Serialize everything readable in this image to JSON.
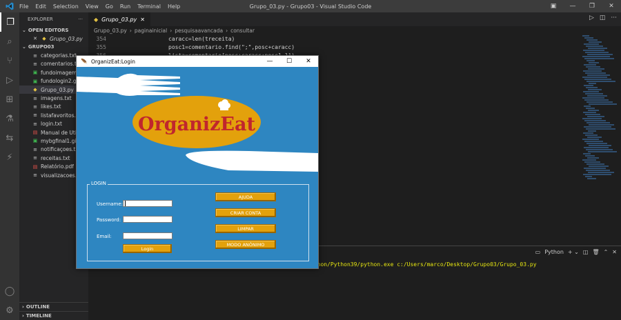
{
  "titlebar": {
    "menu": [
      "File",
      "Edit",
      "Selection",
      "View",
      "Go",
      "Run",
      "Terminal",
      "Help"
    ],
    "title": "Grupo_03.py - Grupo03 - Visual Studio Code"
  },
  "sidebar": {
    "header": "EXPLORER",
    "open_editors_label": "OPEN EDITORS",
    "open_file": "Grupo_03.py",
    "folder_label": "GRUPO03",
    "files": [
      {
        "name": "categorias.txt",
        "icon": "text-file-icon"
      },
      {
        "name": "comentarios.txt",
        "icon": "text-file-icon"
      },
      {
        "name": "fundoimagem...",
        "icon": "image-file-icon"
      },
      {
        "name": "fundologin2.gif",
        "icon": "image-file-icon"
      },
      {
        "name": "Grupo_03.py",
        "icon": "python-file-icon"
      },
      {
        "name": "imagens.txt",
        "icon": "text-file-icon"
      },
      {
        "name": "likes.txt",
        "icon": "text-file-icon"
      },
      {
        "name": "listafavoritos.txt",
        "icon": "text-file-icon"
      },
      {
        "name": "login.txt",
        "icon": "text-file-icon"
      },
      {
        "name": "Manual de Utili...",
        "icon": "pdf-file-icon"
      },
      {
        "name": "mybgfinal1.gif",
        "icon": "image-file-icon"
      },
      {
        "name": "notificaçoes.txt",
        "icon": "text-file-icon"
      },
      {
        "name": "receitas.txt",
        "icon": "text-file-icon"
      },
      {
        "name": "Relatório.pdf",
        "icon": "pdf-file-icon"
      },
      {
        "name": "visualizacoes.txt",
        "icon": "text-file-icon"
      }
    ],
    "outline_label": "OUTLINE",
    "timeline_label": "TIMELINE"
  },
  "editor": {
    "tab_label": "Grupo_03.py",
    "breadcrumb": [
      "Grupo_03.py",
      "paginainicial",
      "pesquisaavancada",
      "consultar"
    ],
    "lines": [
      {
        "num": "354",
        "text": "caracc=len(treceita)"
      },
      {
        "num": "355",
        "text": "posc1=comentario.find(\";\",posc+caracc)"
      },
      {
        "num": "356",
        "text": "lista=comentario[posc+caracc:posc1-1])"
      }
    ]
  },
  "panel": {
    "terminal_label": "Python",
    "terminal_text": "ython/Python39/python.exe c:/Users/marco/Desktop/Grupo03/Grupo_03.py"
  },
  "tk": {
    "title": "OrganizEat:Login",
    "logo_text": "OrganizEat",
    "frame_label": "LOGIN",
    "username_label": "Username:",
    "password_label": "Password:",
    "email_label": "Email:",
    "login_button": "Login",
    "buttons": [
      "AJUDA",
      "CRIAR CONTA",
      "LIMPAR",
      "MODO ANÓNIMO"
    ],
    "colors": {
      "background": "#2e86c1",
      "button": "#e3a10c",
      "logo_ellipse": "#e3a10c",
      "logo_text": "#c0262d"
    }
  }
}
